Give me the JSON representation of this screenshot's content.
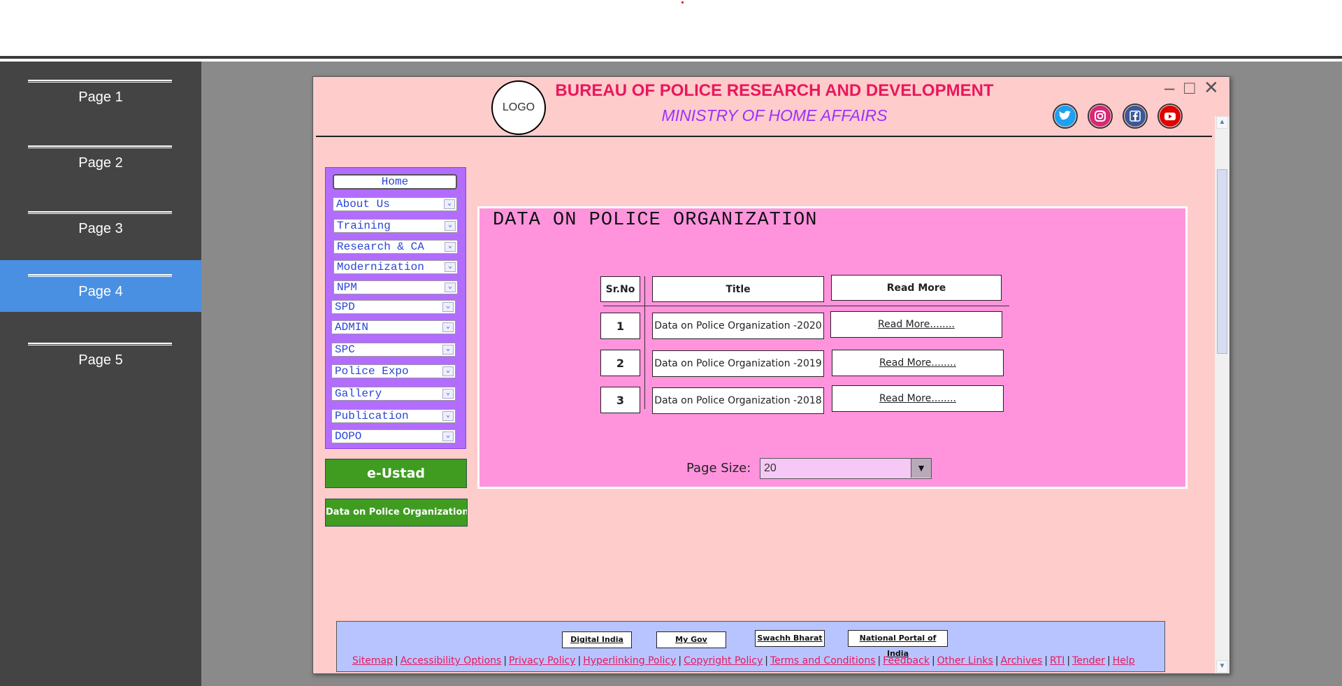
{
  "pages": [
    {
      "label": "Page 1"
    },
    {
      "label": "Page 2"
    },
    {
      "label": "Page 3"
    },
    {
      "label": "Page 4",
      "active": true
    },
    {
      "label": "Page 5"
    }
  ],
  "header": {
    "logo": "LOGO",
    "title": "BUREAU OF POLICE RESEARCH AND DEVELOPMENT",
    "subtitle": "MINISTRY OF HOME AFFAIRS",
    "social_icons": [
      "twitter-icon",
      "instagram-icon",
      "facebook-icon",
      "youtube-icon"
    ]
  },
  "menu": {
    "home": "Home",
    "items": [
      "About Us",
      "Training",
      "Research & CA",
      "Modernization",
      "NPM",
      "SPD",
      "ADMIN",
      "SPC",
      "Police Expo",
      "Gallery",
      "Publication",
      "DOPO"
    ]
  },
  "side_buttons": {
    "eustad": "e-Ustad",
    "dopo": "Data on Police Organization"
  },
  "main": {
    "title": "DATA ON POLICE ORGANIZATION",
    "columns": [
      "Sr.No",
      "Title",
      "Read More"
    ],
    "rows": [
      {
        "sr": "1",
        "title": "Data on Police Organization -2020",
        "read_more": "Read More........"
      },
      {
        "sr": "2",
        "title": "Data on Police Organization -2019",
        "read_more": "Read More........"
      },
      {
        "sr": "3",
        "title": "Data on Police Organization -2018",
        "read_more": "Read More........"
      }
    ],
    "page_size_label": "Page Size:",
    "page_size_value": "20"
  },
  "footer": {
    "buttons": [
      "Digital India",
      "My Gov",
      "Swachh Bharat",
      "National Portal of India"
    ],
    "links": [
      "Sitemap",
      "Accessibility Options",
      "Privacy Policy",
      "Hyperlinking Policy",
      "Copyright Policy",
      "Terms and Conditions",
      "Feedback",
      "Other Links",
      "Archives",
      "RTI",
      "Tender",
      "Help"
    ]
  },
  "colors": {
    "page_bg": "#ffcccc",
    "menu_bg": "#b26cff",
    "panel_bg": "#ff94dd",
    "footer_bg": "#b8c4ff",
    "green_button": "#3f9c20",
    "title_red": "#e8185c",
    "subtitle_purple": "#9b30ff",
    "active_page": "#4a90e2"
  }
}
